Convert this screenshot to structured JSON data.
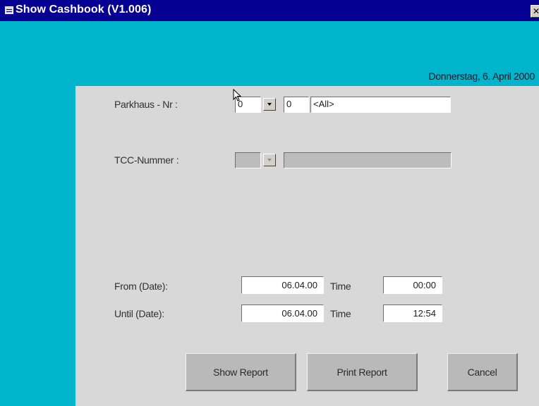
{
  "window": {
    "title": "Show Cashbook (V1.006)",
    "close_icon": "close-icon"
  },
  "header": {
    "date": "Donnerstag, 6. April 2000"
  },
  "colors": {
    "titlebar": "#050092",
    "accent": "#00b4cc",
    "panel": "#d8d8d8"
  },
  "form": {
    "parkhaus": {
      "label": "Parkhaus - Nr :",
      "select_value": "0",
      "id_value": "0",
      "name_value": "<All>"
    },
    "tcc": {
      "label": "TCC-Nummer :",
      "select_value": "",
      "name_value": ""
    },
    "from": {
      "label": "From (Date):",
      "date": "06.04.00",
      "time_label": "Time",
      "time": "00:00"
    },
    "until": {
      "label": "Until (Date):",
      "date": "06.04.00",
      "time_label": "Time",
      "time": "12:54"
    }
  },
  "buttons": {
    "show_report": "Show Report",
    "print_report": "Print Report",
    "cancel": "Cancel"
  }
}
